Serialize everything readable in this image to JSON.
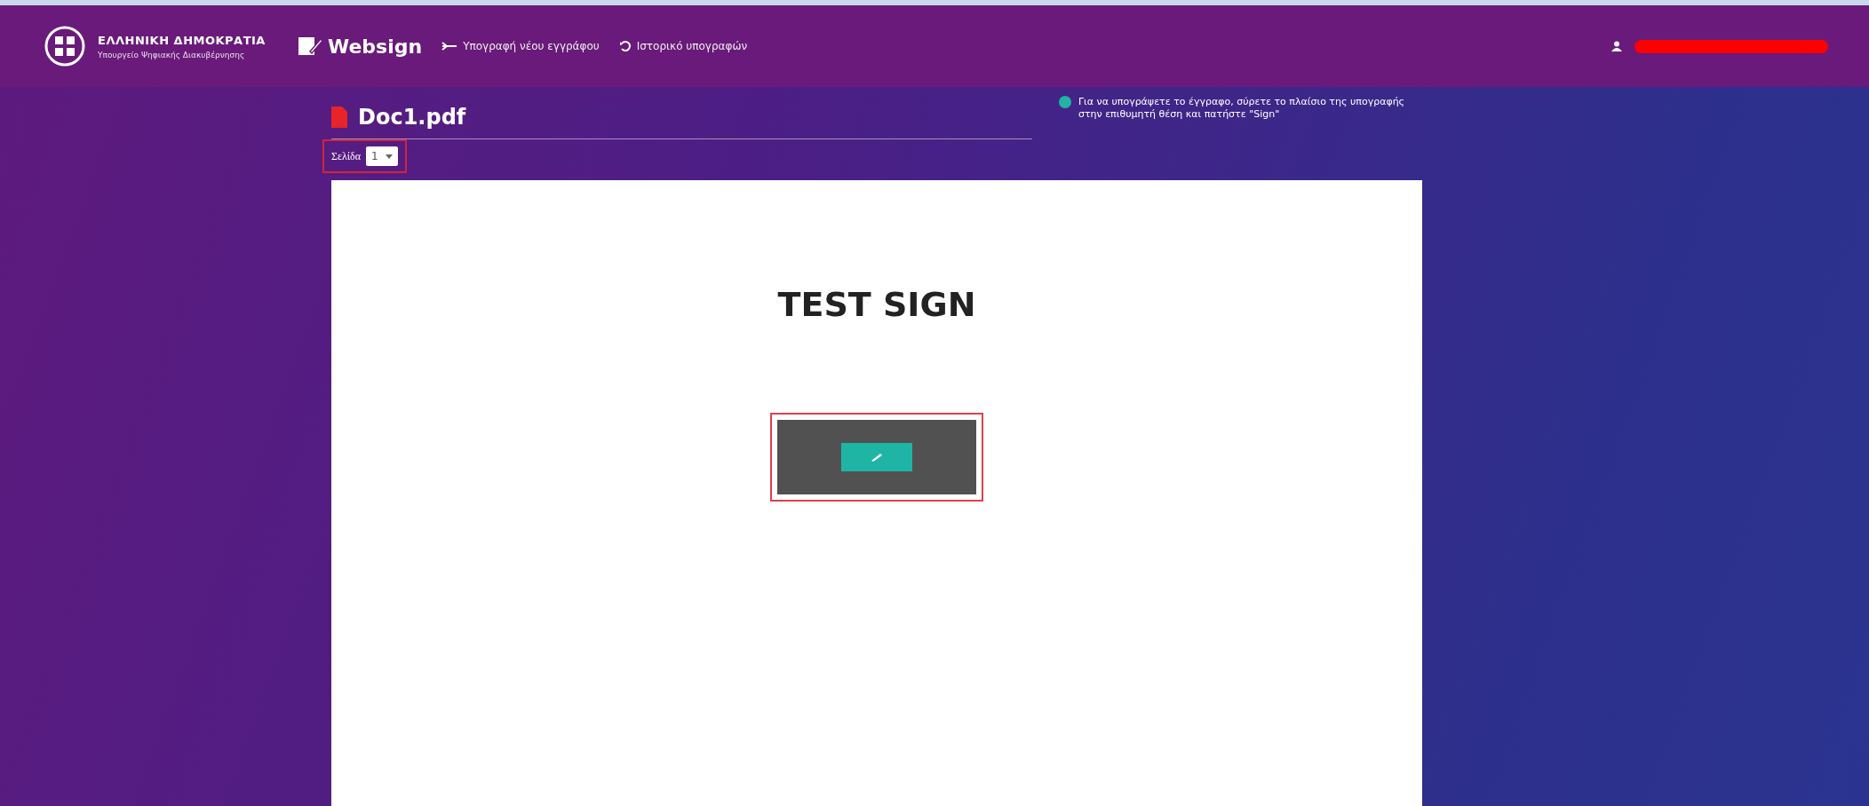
{
  "header": {
    "emblem_title": "ΕΛΛΗΝΙΚΗ ΔΗΜΟΚΡΑΤΙΑ",
    "emblem_subtitle": "Υπουργείο Ψηφιακής Διακυβέρνησης",
    "brand": "Websign",
    "nav": [
      {
        "label": "Υπογραφή νέου εγγράφου",
        "kind": "sign"
      },
      {
        "label": "Ιστορικό υπογραφών",
        "kind": "history"
      }
    ]
  },
  "document": {
    "file_name": "Doc1.pdf",
    "page_label": "Σελίδα",
    "page_value": "1",
    "heading": "TEST SIGN"
  },
  "info": {
    "text": "Για να υπογράψετε το έγγραφο, σύρετε το πλαίσιο της υπογραφής στην επιθυμητή θέση και πατήστε \"Sign\""
  }
}
